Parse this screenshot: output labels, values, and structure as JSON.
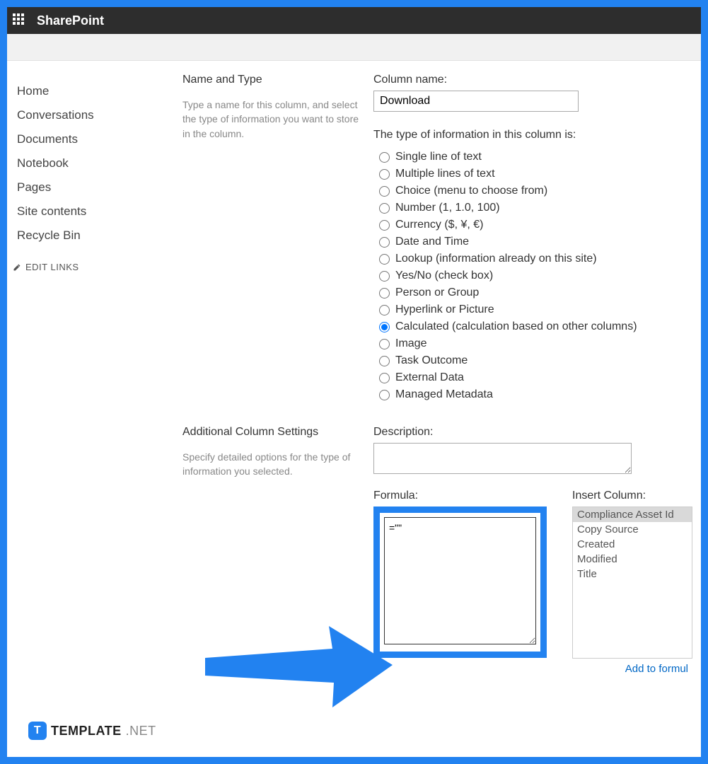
{
  "header": {
    "brand": "SharePoint"
  },
  "sidebar": {
    "items": [
      {
        "label": "Home"
      },
      {
        "label": "Conversations"
      },
      {
        "label": "Documents"
      },
      {
        "label": "Notebook"
      },
      {
        "label": "Pages"
      },
      {
        "label": "Site contents"
      },
      {
        "label": "Recycle Bin"
      }
    ],
    "edit_links": "EDIT LINKS"
  },
  "name_type": {
    "heading": "Name and Type",
    "help": "Type a name for this column, and select the type of information you want to store in the column.",
    "column_name_label": "Column name:",
    "column_name_value": "Download",
    "type_prompt": "The type of information in this column is:",
    "types": [
      "Single line of text",
      "Multiple lines of text",
      "Choice (menu to choose from)",
      "Number (1, 1.0, 100)",
      "Currency ($, ¥, €)",
      "Date and Time",
      "Lookup (information already on this site)",
      "Yes/No (check box)",
      "Person or Group",
      "Hyperlink or Picture",
      "Calculated (calculation based on other columns)",
      "Image",
      "Task Outcome",
      "External Data",
      "Managed Metadata"
    ],
    "selected_index": 10
  },
  "additional": {
    "heading": "Additional Column Settings",
    "help": "Specify detailed options for the type of information you selected.",
    "description_label": "Description:",
    "description_value": "",
    "formula_label": "Formula:",
    "formula_value": "=\"\"",
    "insert_label": "Insert Column:",
    "insert_columns": [
      "Compliance Asset Id",
      "Copy Source",
      "Created",
      "Modified",
      "Title"
    ],
    "insert_selected_index": 0,
    "add_to_formula": "Add to formul"
  },
  "watermark": {
    "t": "T",
    "brand": "TEMPLATE",
    "net": ".NET"
  }
}
